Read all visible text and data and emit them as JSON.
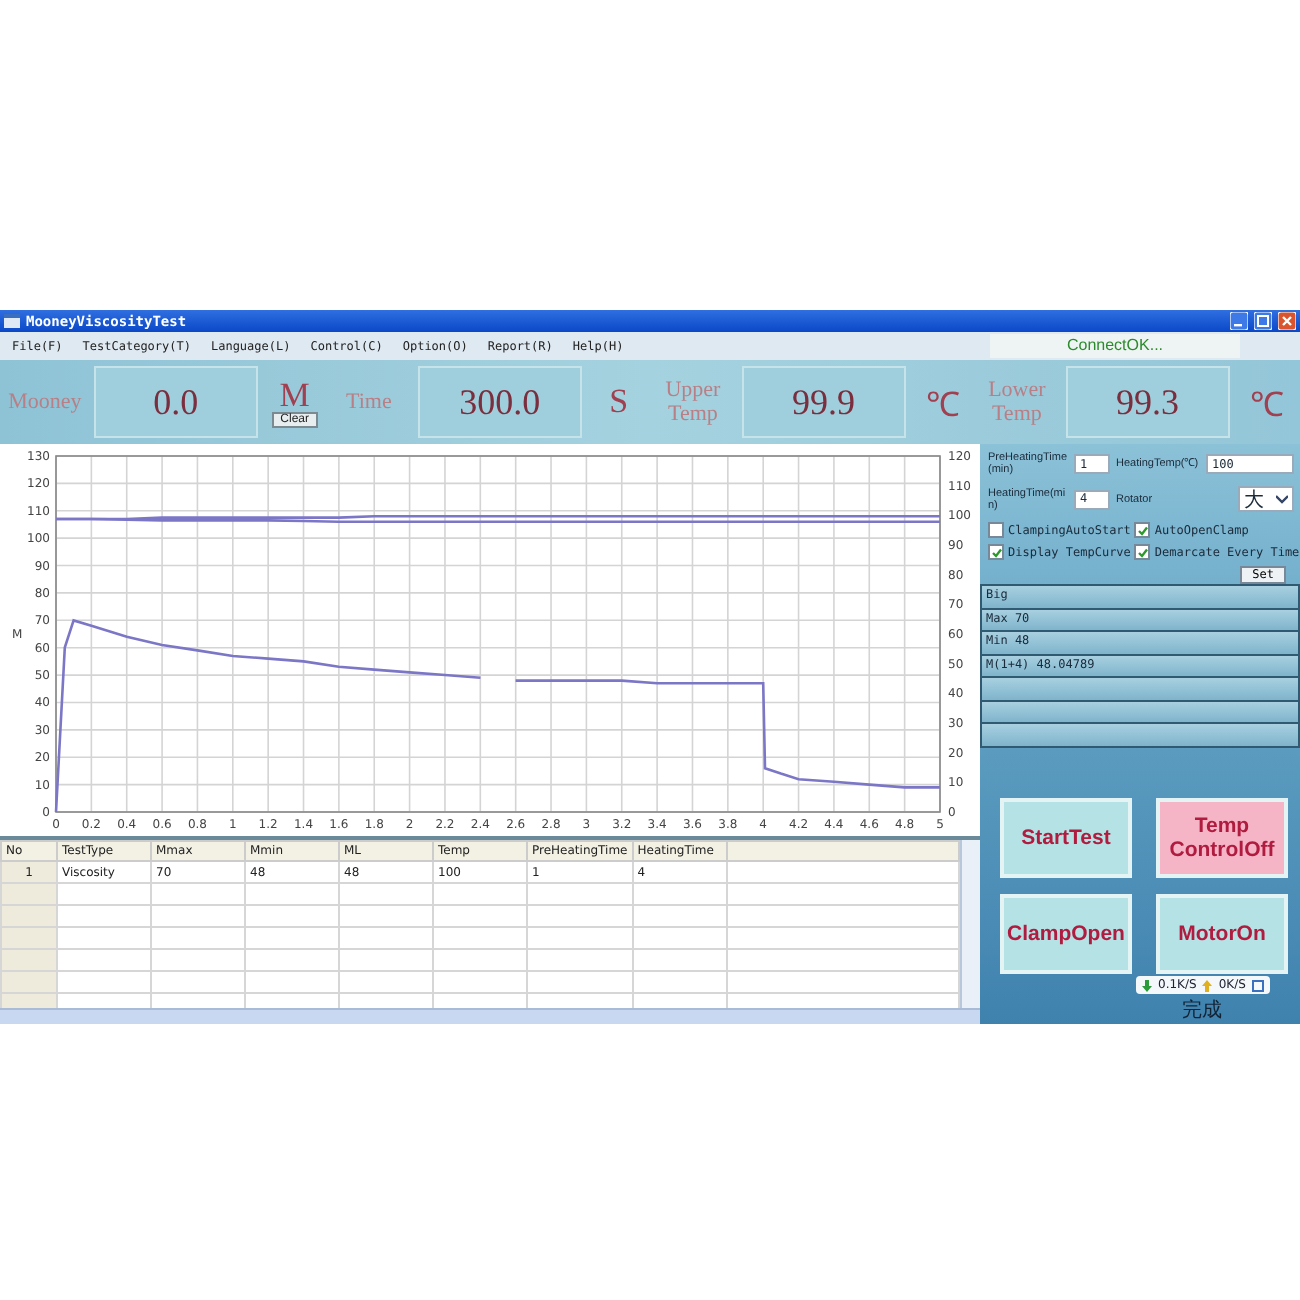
{
  "window": {
    "title": "MooneyViscosityTest"
  },
  "menu": [
    "File(F)",
    "TestCategory(T)",
    "Language(L)",
    "Control(C)",
    "Option(O)",
    "Report(R)",
    "Help(H)"
  ],
  "connection_status": "ConnectOK...",
  "readouts": [
    {
      "label": "Mooney",
      "value": "0.0",
      "unit": "M",
      "button": "Clear"
    },
    {
      "label": "Time",
      "value": "300.0",
      "unit": "S"
    },
    {
      "label": "Upper Temp",
      "value": "99.9",
      "unit": "℃"
    },
    {
      "label": "Lower Temp",
      "value": "99.3",
      "unit": "℃"
    }
  ],
  "chart": {
    "chart_data": {
      "type": "line",
      "ylabel": "M",
      "x": [
        0,
        0.05,
        0.1,
        0.2,
        0.4,
        0.6,
        0.8,
        1,
        1.2,
        1.4,
        1.6,
        1.8,
        2,
        2.2,
        2.4,
        2.5,
        2.6,
        2.8,
        3,
        3.2,
        3.4,
        3.6,
        3.8,
        4,
        4.01,
        4.1,
        4.2,
        4.4,
        4.6,
        4.8,
        5
      ],
      "series": [
        {
          "color": "#7b76c6",
          "values": [
            0,
            60,
            70,
            68,
            64,
            61,
            59,
            57,
            56,
            55,
            53,
            52,
            51,
            50,
            49,
            null,
            48,
            48,
            48,
            48,
            47,
            47,
            47,
            47,
            16,
            14,
            12,
            11,
            10,
            9,
            9
          ]
        },
        {
          "color": "#7b76c6",
          "values": [
            107,
            107,
            107,
            107,
            107,
            107.5,
            107.5,
            107.5,
            107.5,
            107.5,
            107.5,
            108,
            108,
            108,
            108,
            108,
            108,
            108,
            108,
            108,
            108,
            108,
            108,
            108,
            108,
            108,
            108,
            108,
            108,
            108,
            108
          ]
        },
        {
          "color": "#7b76c6",
          "values": [
            107,
            107,
            107,
            107,
            106.8,
            106.5,
            106.5,
            106.5,
            106.5,
            106.3,
            106,
            106,
            106,
            106,
            106,
            106,
            106,
            106,
            106,
            106,
            106,
            106,
            106,
            106,
            106,
            106,
            106,
            106,
            106,
            106,
            106
          ]
        }
      ],
      "xlim": [
        0,
        5
      ],
      "ylim": [
        0,
        130
      ],
      "y2lim": [
        0,
        120
      ],
      "grid": true,
      "xticks": [
        0,
        0.2,
        0.4,
        0.6,
        0.8,
        1,
        1.2,
        1.4,
        1.6,
        1.8,
        2,
        2.2,
        2.4,
        2.6,
        2.8,
        3,
        3.2,
        3.4,
        3.6,
        3.8,
        4,
        4.2,
        4.4,
        4.6,
        4.8,
        5
      ],
      "yticks": [
        0,
        10,
        20,
        30,
        40,
        50,
        60,
        70,
        80,
        90,
        100,
        110,
        120,
        130
      ],
      "y2ticks": [
        0,
        10,
        20,
        30,
        40,
        50,
        60,
        70,
        80,
        90,
        100,
        110,
        120
      ]
    }
  },
  "table": {
    "columns": [
      "No",
      "TestType",
      "Mmax",
      "Mmin",
      "ML",
      "Temp",
      "PreHeatingTime",
      "HeatingTime"
    ],
    "rows": [
      [
        "1",
        "Viscosity",
        "70",
        "48",
        "48",
        "100",
        "1",
        "4"
      ]
    ]
  },
  "settings": {
    "fields": [
      {
        "kind": "input",
        "label": "PreHeatingTime(min)",
        "value": "1"
      },
      {
        "kind": "input",
        "label": "HeatingTemp(℃)",
        "value": "100"
      },
      {
        "kind": "input",
        "label": "HeatingTime(min)",
        "value": "4"
      },
      {
        "kind": "select",
        "label": "Rotator",
        "value": "大"
      }
    ],
    "checkboxes": [
      {
        "label": "ClampingAutoStart",
        "checked": false
      },
      {
        "label": "AutoOpenClamp",
        "checked": true
      },
      {
        "label": "Display TempCurve",
        "checked": true
      },
      {
        "label": "Demarcate Every Time",
        "checked": true
      }
    ],
    "set_button": "Set",
    "results": [
      "Big",
      "Max 70",
      "Min 48",
      "M(1+4) 48.04789"
    ]
  },
  "action_buttons": [
    {
      "label": "StartTest",
      "highlighted": false
    },
    {
      "label": "Temp ControlOff",
      "highlighted": true
    },
    {
      "label": "ClampOpen",
      "highlighted": false
    },
    {
      "label": "MotorOn",
      "highlighted": false
    }
  ],
  "network_speed": {
    "down": "0.1K/S",
    "up": "0K/S"
  },
  "status_text": "完成"
}
